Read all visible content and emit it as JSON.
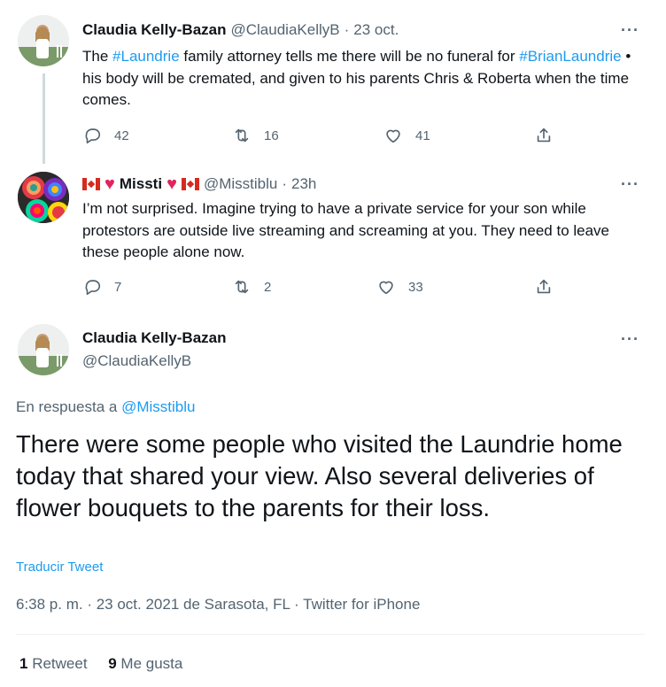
{
  "tweet1": {
    "name": "Claudia Kelly-Bazan",
    "handle": "@ClaudiaKellyB",
    "sep": "·",
    "date": "23 oct.",
    "more": "···",
    "text_parts": [
      "The ",
      "#Laundrie",
      " family attorney tells me there will be no funeral for ",
      "#BrianLaundrie",
      " • his body will be cremated, and given to his parents Chris & Roberta when the time comes."
    ],
    "replies": "42",
    "retweets": "16",
    "likes": "41"
  },
  "tweet2": {
    "name": "Missti",
    "handle": "@Misstiblu",
    "sep": "·",
    "date": "23h",
    "more": "···",
    "text": "I’m not surprised. Imagine trying to have a private service for your son while protestors are outside live streaming and screaming at you. They need to leave these people alone now.",
    "replies": "7",
    "retweets": "2",
    "likes": "33"
  },
  "main": {
    "name": "Claudia Kelly-Bazan",
    "handle": "@ClaudiaKellyB",
    "more": "···",
    "reply_prefix": "En respuesta a",
    "reply_to": "@Misstiblu",
    "text": "There were some people who visited the Laundrie home today that shared your view. Also several deliveries of flower bouquets to the parents for their loss.",
    "translate": "Traducir Tweet",
    "meta": "6:38 p. m. · 23 oct. 2021 de Sarasota, FL · Twitter for iPhone",
    "retweet_count": "1",
    "retweet_label": "Retweet",
    "like_count": "9",
    "like_label": "Me gusta"
  },
  "icons": {
    "reply": "reply-icon",
    "retweet": "retweet-icon",
    "like": "heart-icon",
    "share": "share-icon",
    "flag": "canada-flag-icon"
  },
  "colors": {
    "link": "#1d9bf0",
    "muted": "#536471",
    "heart": "#e0245e"
  }
}
